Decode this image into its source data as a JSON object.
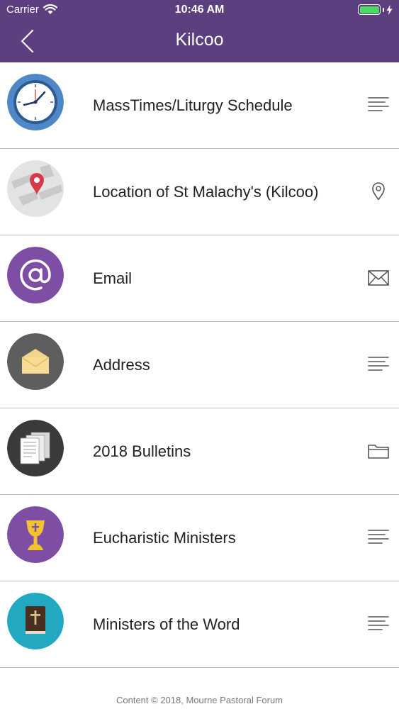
{
  "status_bar": {
    "carrier": "Carrier",
    "time": "10:46 AM",
    "battery_color": "#4cd964"
  },
  "nav": {
    "title": "Kilcoo",
    "back_icon": "chevron-left-icon",
    "bar_color": "#5b3f7f"
  },
  "items": [
    {
      "label": "MassTimes/Liturgy Schedule",
      "icon": "clock-icon",
      "accessory": "list-lines-icon",
      "icon_bg": "#4f88c6"
    },
    {
      "label": "Location of St Malachy's (Kilcoo)",
      "icon": "map-pin-icon",
      "accessory": "location-pin-icon",
      "icon_bg": "#e3e3e3"
    },
    {
      "label": "Email",
      "icon": "at-sign-icon",
      "accessory": "envelope-icon",
      "icon_bg": "#7d4ea3"
    },
    {
      "label": "Address",
      "icon": "open-envelope-icon",
      "accessory": "list-lines-icon",
      "icon_bg": "#5e5e5e"
    },
    {
      "label": "2018 Bulletins",
      "icon": "documents-icon",
      "accessory": "folder-icon",
      "icon_bg": "#3a3a3a"
    },
    {
      "label": "Eucharistic Ministers",
      "icon": "chalice-icon",
      "accessory": "list-lines-icon",
      "icon_bg": "#7d4ea3"
    },
    {
      "label": "Ministers of the Word",
      "icon": "bible-icon",
      "accessory": "list-lines-icon",
      "icon_bg": "#22a8c0"
    }
  ],
  "footer": {
    "text": "Content © 2018, Mourne Pastoral Forum"
  }
}
